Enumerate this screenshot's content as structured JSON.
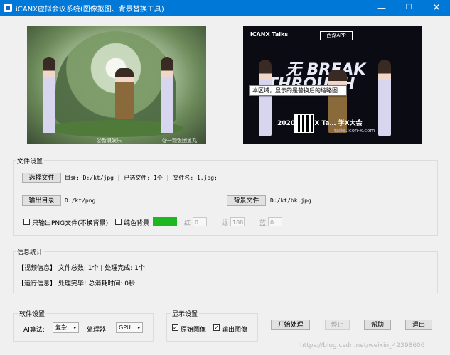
{
  "window": {
    "title": "iCANX虚拟会议系统(图像抠图、背景替换工具)",
    "minimize": "—",
    "maximize": "☐",
    "close": "✕"
  },
  "images": {
    "original_watermarks": [
      "@新浪娱乐",
      "@一颗饭团鱼丸"
    ],
    "output": {
      "logo": "iCANX Talks",
      "app_badge": "西湖APP",
      "headline_1": "无 BREAK",
      "headline_2": "THROUGH",
      "slogan": "2020  iCANX Ta…   学X大会",
      "url": "talks.icon-x.com"
    },
    "tooltip": "本区域，显示的是替换后的缩略图..."
  },
  "file_settings": {
    "title": "文件设置",
    "select_file_button": "选择文件",
    "dir_info": "目录: D:/kt/jpg | 已选文件: 1个 | 文件名: 1.jpg;",
    "output_dir_button": "输出目录",
    "output_dir": "D:/kt/png",
    "bg_file_button": "背景文件",
    "bg_file": "D:/kt/bk.jpg",
    "png_only_label": "只输出PNG文件(不换背景)",
    "solid_bg_label": "纯色背景",
    "solid_color": "#1fb71f",
    "r_label": "红",
    "r_value": "0",
    "g_label": "绿",
    "g_value": "188",
    "b_label": "蓝",
    "b_value": "0"
  },
  "info": {
    "title": "信息统计",
    "video_info": "【视频信息】 文件总数: 1个 | 处理完成: 1个",
    "run_info": "【运行信息】 处理完毕! 总消耗时间: 0秒"
  },
  "software": {
    "title": "软件设置",
    "algo_label": "AI算法:",
    "algo_value": "复杂",
    "proc_label": "处理器:",
    "proc_value": "GPU"
  },
  "display": {
    "title": "显示设置",
    "original_label": "原始图像",
    "output_label": "输出图像"
  },
  "actions": {
    "start": "开始处理",
    "stop": "停止",
    "help": "帮助",
    "exit": "退出"
  },
  "watermark": "https://blog.csdn.net/weixin_42398606"
}
